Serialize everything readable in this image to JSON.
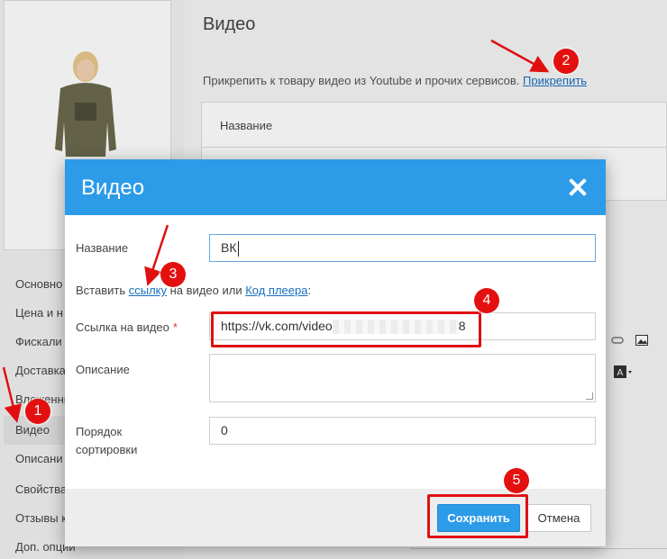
{
  "page": {
    "title": "Видео",
    "description": "Прикрепить к товару видео из Youtube и прочих сервисов.",
    "attach_link": "Прикрепить",
    "table_header_name": "Название"
  },
  "sidebar": {
    "items": [
      {
        "label": "Основно"
      },
      {
        "label": "Цена и н"
      },
      {
        "label": "Фискали"
      },
      {
        "label": "Доставка"
      },
      {
        "label": "Вложенные"
      },
      {
        "label": "Видео"
      },
      {
        "label": "Описани"
      },
      {
        "label": "Свойства"
      },
      {
        "label": "Отзывы к"
      },
      {
        "label": "Доп. опции"
      }
    ]
  },
  "modal": {
    "title": "Видео",
    "close_icon": "close-icon",
    "fields": {
      "name_label": "Название",
      "name_value": "ВК",
      "insert_prefix": "Вставить",
      "insert_link_label": "ссылку",
      "insert_middle": "на видео или",
      "insert_player_label": "Код плеера",
      "insert_suffix": ":",
      "url_label": "Ссылка на видео",
      "url_required_mark": "*",
      "url_value_start": "https://vk.com/video",
      "url_value_end": "8",
      "description_label": "Описание",
      "sort_label_line1": "Порядок",
      "sort_label_line2": "сортировки",
      "sort_value": "0"
    },
    "buttons": {
      "save": "Сохранить",
      "cancel": "Отмена"
    }
  },
  "annotations": {
    "accent_color": "#e41010",
    "steps": [
      "1",
      "2",
      "3",
      "4",
      "5"
    ]
  },
  "colors": {
    "header_blue": "#2c9be8",
    "link_blue": "#1a70c0"
  }
}
